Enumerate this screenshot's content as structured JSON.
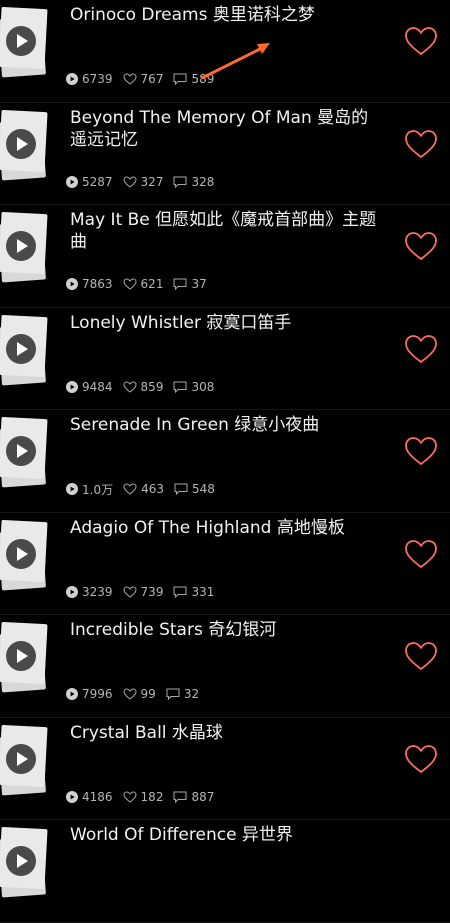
{
  "songs": [
    {
      "title": "Orinoco Dreams 奥里诺科之梦",
      "plays": "6739",
      "likes": "767",
      "comments": "589"
    },
    {
      "title": "Beyond The Memory Of Man 曼岛的遥远记忆",
      "plays": "5287",
      "likes": "327",
      "comments": "328"
    },
    {
      "title": "May It Be 但愿如此《魔戒首部曲》主题曲",
      "plays": "7863",
      "likes": "621",
      "comments": "37"
    },
    {
      "title": "Lonely Whistler 寂寞口笛手",
      "plays": "9484",
      "likes": "859",
      "comments": "308"
    },
    {
      "title": "Serenade In Green 绿意小夜曲",
      "plays": "1.0万",
      "likes": "463",
      "comments": "548"
    },
    {
      "title": "Adagio Of The Highland 高地慢板",
      "plays": "3239",
      "likes": "739",
      "comments": "331"
    },
    {
      "title": "Incredible Stars 奇幻银河",
      "plays": "7996",
      "likes": "99",
      "comments": "32"
    },
    {
      "title": "Crystal Ball 水晶球",
      "plays": "4186",
      "likes": "182",
      "comments": "887"
    },
    {
      "title": "World Of Difference 异世界",
      "plays": "",
      "likes": "",
      "comments": ""
    }
  ],
  "colors": {
    "heart": "#ff6f61",
    "annotation_arrow": "#ff6a2b",
    "background": "#000000"
  },
  "icons": {
    "play": "play-icon",
    "plays": "play-count-icon",
    "likes": "heart-outline-icon",
    "comments": "comment-icon",
    "favorite": "heart-icon"
  }
}
